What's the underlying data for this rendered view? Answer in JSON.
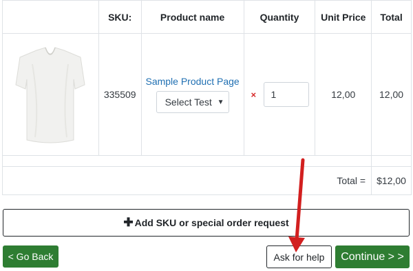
{
  "table": {
    "headers": {
      "sku": "SKU:",
      "product_name": "Product name",
      "quantity": "Quantity",
      "unit_price": "Unit Price",
      "total": "Total"
    },
    "row": {
      "sku": "335509",
      "product_link": "Sample Product Page",
      "select_value": "Select Test",
      "quantity": "1",
      "remove_glyph": "×",
      "unit_price": "12,00",
      "total": "12,00"
    },
    "summary": {
      "label": "Total =",
      "value": "$12,00"
    }
  },
  "actions": {
    "add_sku": "Add SKU or special order request",
    "go_back": "< Go Back",
    "ask_help": "Ask for help",
    "continue": "Continue > >"
  },
  "icons": {
    "product_image": "tshirt-image",
    "plus": "plus-icon",
    "remove": "remove-icon",
    "annotation": "red-arrow"
  },
  "colors": {
    "primary_green": "#2e7d32",
    "link_blue": "#1f6fb2",
    "remove_red": "#d62828",
    "annotation_red": "#d21f1f"
  }
}
